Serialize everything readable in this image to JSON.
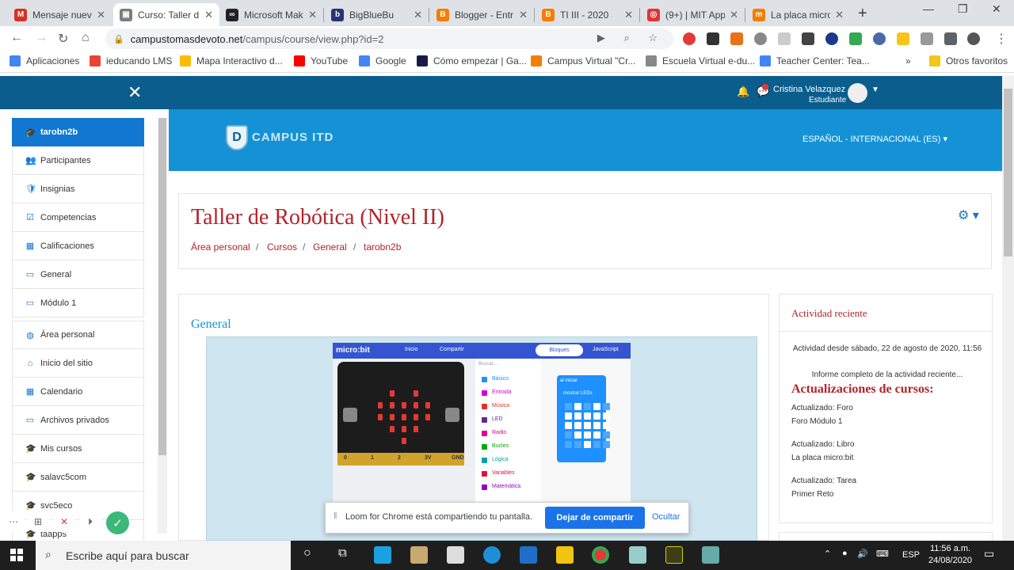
{
  "browser": {
    "tabs": [
      {
        "label": "Mensaje nuev",
        "color": "#d93025",
        "glyph": "M"
      },
      {
        "label": "Curso: Taller d",
        "color": "#7c7c7c",
        "glyph": "▣"
      },
      {
        "label": "Microsoft Mak",
        "color": "#202124",
        "glyph": "∞"
      },
      {
        "label": "BigBlueBu",
        "color": "#283274",
        "glyph": "b"
      },
      {
        "label": "Blogger - Entr",
        "color": "#f57d00",
        "glyph": "B"
      },
      {
        "label": "TI III - 2020",
        "color": "#f57d00",
        "glyph": "B"
      },
      {
        "label": "(9+) | MIT App",
        "color": "#e3342f",
        "glyph": "◎"
      },
      {
        "label": "La placa micro",
        "color": "#f57d00",
        "glyph": "m"
      }
    ],
    "url_host": "campustomasdevoto.net",
    "url_path": "/campus/course/view.php?id=2",
    "bookmarks": [
      {
        "label": "Aplicaciones",
        "color": "#4285f4"
      },
      {
        "label": "ieducando LMS",
        "color": "#ea4335"
      },
      {
        "label": "Mapa Interactivo d...",
        "color": "#fbbc04"
      },
      {
        "label": "YouTube",
        "color": "#ff0000"
      },
      {
        "label": "Google",
        "color": "#4285f4"
      },
      {
        "label": "Cómo empezar | Ga...",
        "color": "#1a1a4a"
      },
      {
        "label": "Campus Virtual \"Cr...",
        "color": "#f57d00"
      },
      {
        "label": "Escuela Virtual e-du...",
        "color": "#888888"
      },
      {
        "label": "Teacher Center: Tea...",
        "color": "#4285f4"
      }
    ],
    "bookmarks_more": "»",
    "other_bookmarks": "Otros favoritos"
  },
  "moodle": {
    "user_name": "Cristina Velazquez",
    "user_role": "Estudiante",
    "site_logo": "CAMPUS ITD",
    "language": "ESPAÑOL - INTERNACIONAL (ES)",
    "course_title": "Taller de Robótica (Nivel II)",
    "breadcrumb": [
      "Área personal",
      "Cursos",
      "General",
      "tarobn2b"
    ],
    "section_title": "General",
    "drawer": [
      {
        "label": "tarobn2b",
        "icon": "🎓",
        "active": true
      },
      {
        "label": "Participantes",
        "icon": "👥"
      },
      {
        "label": "Insignias",
        "icon": "🛡"
      },
      {
        "label": "Competencias",
        "icon": "☑"
      },
      {
        "label": "Calificaciones",
        "icon": "▦"
      },
      {
        "label": "General",
        "icon": "▭"
      },
      {
        "label": "Módulo 1",
        "icon": "▭"
      }
    ],
    "drawer2": [
      {
        "label": "Área personal",
        "icon": "◍"
      },
      {
        "label": "Inicio del sitio",
        "icon": "⌂"
      },
      {
        "label": "Calendario",
        "icon": "▦"
      },
      {
        "label": "Archivos privados",
        "icon": "▭"
      },
      {
        "label": "Mis cursos",
        "icon": "🎓"
      },
      {
        "label": "salavc5com",
        "icon": "🎓"
      },
      {
        "label": "svc5eco",
        "icon": "🎓"
      },
      {
        "label": "taapps",
        "icon": "🎓"
      }
    ],
    "activity": {
      "title": "Actividad reciente",
      "since": "Actividad desde sábado, 22 de agosto de 2020, 11:56",
      "report": "Informe completo de la actividad reciente...",
      "updates_heading": "Actualizaciones de cursos:",
      "items": [
        {
          "type": "Actualizado: Foro",
          "name": "Foro Módulo 1"
        },
        {
          "type": "Actualizado: Libro",
          "name": "La placa micro:bit"
        },
        {
          "type": "Actualizado: Tarea",
          "name": "Primer Reto"
        }
      ]
    },
    "microbit": {
      "logo": "micro:bit",
      "nav_home": "Inicio",
      "nav_share": "Compartir",
      "mode_blocks": "Bloques",
      "mode_js": "JavaScript",
      "search": "Buscar...",
      "categories": [
        {
          "label": "Básico",
          "color": "#1e90ff"
        },
        {
          "label": "Entrada",
          "color": "#d400d4"
        },
        {
          "label": "Música",
          "color": "#e63022"
        },
        {
          "label": "LED",
          "color": "#5c2d91"
        },
        {
          "label": "Radio",
          "color": "#e3008c"
        },
        {
          "label": "Bucles",
          "color": "#00aa00"
        },
        {
          "label": "Lógica",
          "color": "#00a4a6"
        },
        {
          "label": "Variables",
          "color": "#dc143c"
        },
        {
          "label": "Matemática",
          "color": "#9400d3"
        }
      ],
      "block_on_start": "al iniciar",
      "block_show_leds": "mostrar LEDs",
      "pins": [
        "0",
        "1",
        "2",
        "3V",
        "GND"
      ]
    }
  },
  "loom": {
    "message": "Loom for Chrome está compartiendo tu pantalla.",
    "stop": "Dejar de compartir",
    "hide": "Ocultar"
  },
  "taskbar": {
    "search_placeholder": "Escribe aquí para buscar",
    "lang": "ESP",
    "time": "11:56 a.m.",
    "date": "24/08/2020"
  }
}
